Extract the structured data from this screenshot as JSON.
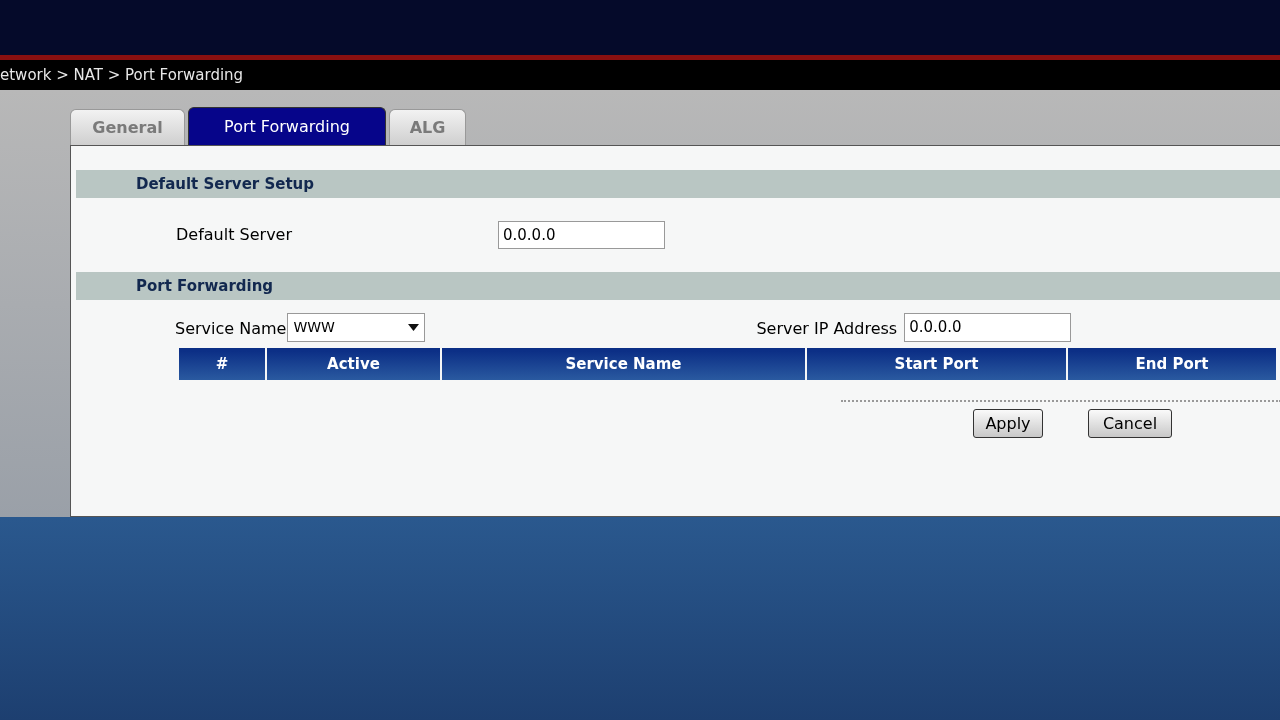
{
  "breadcrumb": "etwork > NAT > Port Forwarding",
  "tabs": [
    {
      "label": "General",
      "selected": false
    },
    {
      "label": "Port Forwarding",
      "selected": true
    },
    {
      "label": "ALG",
      "selected": false
    }
  ],
  "default_server_setup": {
    "heading": "Default Server Setup",
    "label": "Default Server",
    "value": "0.0.0.0"
  },
  "port_forwarding": {
    "heading": "Port Forwarding",
    "service_name_label": "Service Name",
    "service_name_value": "WWW",
    "server_ip_label": "Server IP Address",
    "server_ip_value": "0.0.0.0",
    "table": {
      "columns": [
        "#",
        "Active",
        "Service Name",
        "Start Port",
        "End Port"
      ]
    }
  },
  "buttons": [
    "Apply",
    "Cancel"
  ]
}
